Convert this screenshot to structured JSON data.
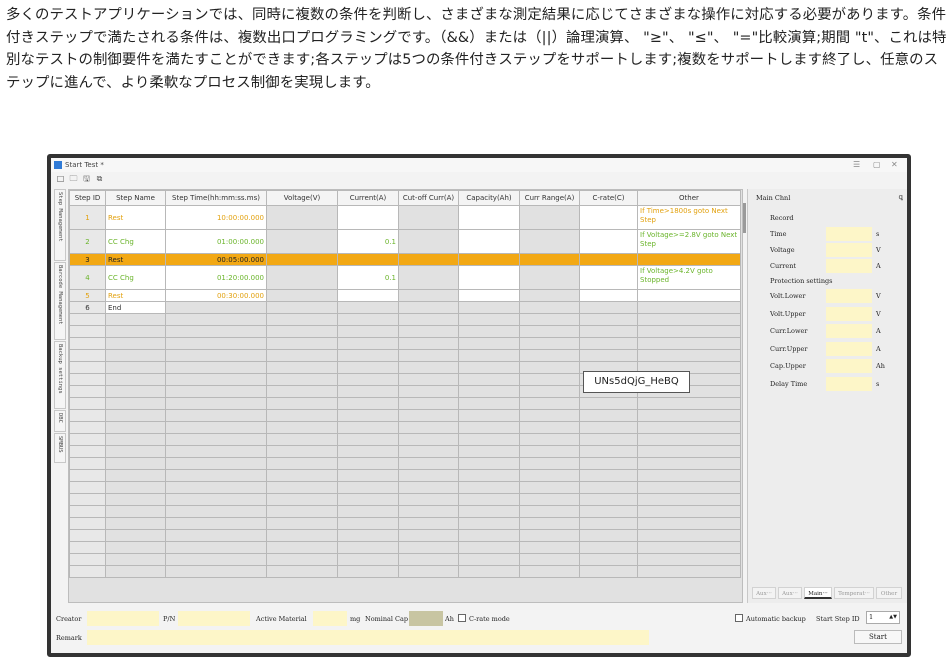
{
  "intro_text": "多くのテストアプリケーションでは、同時に複数の条件を判断し、さまざまな測定結果に応じてさまざまな操作に対応する必要があります。条件付きステップで満たされる条件は、複数出口プログラミングです。（&&）または（||）論理演算、 \"≥\"、 \"≤\"、 \"=\"比較演算;期間 \"t\"、これは特別なテストの制御要件を満たすことができます;各ステップは5つの条件付きステップをサポートします;複数をサポートします終了し、任意のステップに進んで、より柔軟なプロセス制御を実現します。",
  "window": {
    "title": "Start Test *",
    "controls": [
      "☰",
      "▢",
      "✕"
    ],
    "toolbar_icons": [
      "new-file-icon",
      "open-folder-icon",
      "save-icon",
      "save-all-icon"
    ]
  },
  "side_tabs": [
    "Step Management",
    "Barcode Management",
    "Backup settings",
    "DBC",
    "SMBUS"
  ],
  "grid": {
    "columns": [
      "Step ID",
      "Step Name",
      "Step Time(hh:mm:ss.ms)",
      "Voltage(V)",
      "Current(A)",
      "Cut-off Curr(A)",
      "Capacity(Ah)",
      "Curr Range(A)",
      "C-rate(C)",
      "Other"
    ],
    "rows": [
      {
        "id": "1",
        "name": "Rest",
        "time": "10:00:00.000",
        "voltage": "",
        "current": "",
        "other": "If  Time>1800s goto Next Step"
      },
      {
        "id": "2",
        "name": "CC Chg",
        "time": "01:00:00.000",
        "voltage": "",
        "current": "0.1",
        "other": "If  Voltage>=2.8V goto Next Step"
      },
      {
        "id": "3",
        "name": "Rest",
        "time": "00:05:00.000",
        "voltage": "",
        "current": "",
        "other": ""
      },
      {
        "id": "4",
        "name": "CC Chg",
        "time": "01:20:00.000",
        "voltage": "",
        "current": "0.1",
        "other": "If  Voltage>4.2V goto Stopped"
      },
      {
        "id": "5",
        "name": "Rest",
        "time": "00:30:00.000",
        "voltage": "",
        "current": "",
        "other": ""
      },
      {
        "id": "6",
        "name": "End",
        "time": "",
        "voltage": "",
        "current": "",
        "other": ""
      }
    ]
  },
  "tooltip": "UNs5dQjG_HeBQ",
  "right_panel": {
    "title": "Main Chnl",
    "pin": "ꝗ",
    "record_label": "Record",
    "record_rows": [
      {
        "label": "Time",
        "unit": "s"
      },
      {
        "label": "Voltage",
        "unit": "V"
      },
      {
        "label": "Current",
        "unit": "A"
      }
    ],
    "protection_label": "Protection settings",
    "protection_rows": [
      {
        "label": "Volt.Lower",
        "unit": "V"
      },
      {
        "label": "Volt.Upper",
        "unit": "V"
      },
      {
        "label": "Curr.Lower",
        "unit": "A"
      },
      {
        "label": "Curr.Upper",
        "unit": "A"
      },
      {
        "label": "Cap.Upper",
        "unit": "Ah"
      },
      {
        "label": "Delay Time",
        "unit": "s"
      }
    ],
    "tabs": [
      "Aux···",
      "Aux···",
      "Main···",
      "Temperat···",
      "Other"
    ]
  },
  "bottom": {
    "creator_label": "Creator",
    "pn_label": "P/N",
    "active_material_label": "Active Material",
    "mg_unit": "mg",
    "nominal_cap_label": "Nominal Cap",
    "ah_unit": "Ah",
    "crate_mode_label": "C-rate mode",
    "remark_label": "Remark",
    "auto_backup_label": "Automatic backup",
    "start_step_label": "Start Step ID",
    "start_step_value": "1",
    "start_button": "Start"
  }
}
